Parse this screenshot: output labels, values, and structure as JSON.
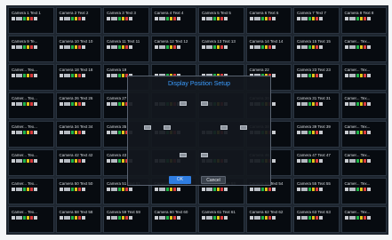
{
  "dialog": {
    "title": "Display Position Setup",
    "ok_label": "OK",
    "cancel_label": "Cancel"
  },
  "cameras": [
    "Camera 1 Text 1",
    "Camera 2 Text 2",
    "Camera 3 Text 3",
    "Camera 4 Text 4",
    "Camera 5 Text 5",
    "Camera 6 Text 6",
    "Camera 7 Text 7",
    "Camera 8 Text 8",
    "Camera 9 Te...",
    "Camera 10 Text 10",
    "Camera 11 Text 11",
    "Camera 12 Text 12",
    "Camera 13 Text 13",
    "Camera 14 Text 14",
    "Camera 15 Text 15",
    "Camer... Tex...",
    "Camer... Tex...",
    "Camera 18 Text 18",
    "Camera 19",
    "",
    "",
    "Camera 22",
    "Camera 23 Text 23",
    "Camer... Tex...",
    "Camer... Tex...",
    "Camera 26 Text 26",
    "Camera 27",
    "",
    "",
    "Camera 30",
    "Camera 31 Text 31",
    "Camer... Tex...",
    "Camer... Tex...",
    "Camera 34 Text 34",
    "Camera 35",
    "",
    "",
    "Camera 38",
    "Camera 39 Text 39",
    "Camer... Tex...",
    "Camer... Tex...",
    "Camera 42 Text 42",
    "Camera 43",
    "",
    "",
    "Camera 46",
    "Camera 47 Text 47",
    "Camer... Tex...",
    "Camer... Tex...",
    "Camera 50 Text 50",
    "Camera 51 Text 51",
    "Camera 52 Text 52",
    "Camera 53 Text 53",
    "Camera 54 Text 54",
    "Camera 55 Text 55",
    "Camer... Tex...",
    "Camer... Tex...",
    "Camera 58 Text 58",
    "Camera 59 Text 59",
    "Camera 60 Text 60",
    "Camera 61 Text 61",
    "Camera 62 Text 62",
    "Camera 63 Text 63",
    "Camer... Tex..."
  ],
  "colors": {
    "accent": "#3b9dff",
    "ok_button": "#2f7de1"
  }
}
